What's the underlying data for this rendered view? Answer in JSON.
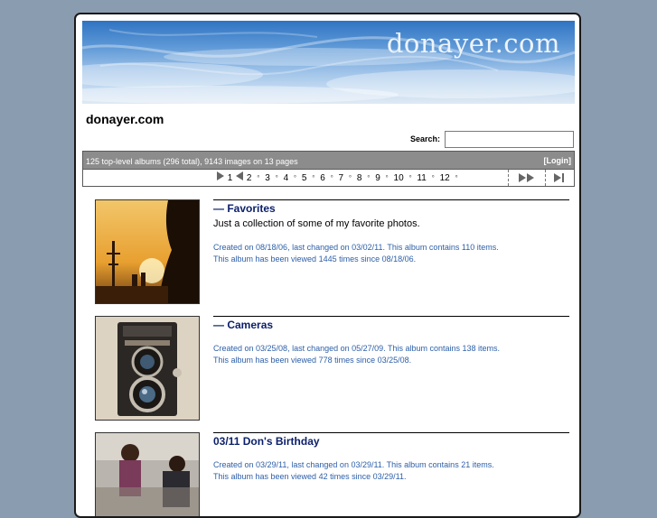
{
  "header": {
    "banner_title": "donayer.com",
    "site_title": "donayer.com",
    "search_label": "Search:",
    "search_value": ""
  },
  "info_bar": {
    "summary": "125 top-level albums (296 total), 9143 images on 13 pages",
    "login": "[Login]"
  },
  "pager": {
    "pages": [
      "1",
      "2",
      "3",
      "4",
      "5",
      "6",
      "7",
      "8",
      "9",
      "10",
      "11",
      "12"
    ]
  },
  "albums": [
    {
      "title": "— Favorites",
      "description": "Just a collection of some of my favorite photos.",
      "meta_line1": "Created on 08/18/06, last changed on 03/02/11. This album contains 110 items.",
      "meta_line2": "This album has been viewed 1445 times since 08/18/06."
    },
    {
      "title": "— Cameras",
      "description": "",
      "meta_line1": "Created on 03/25/08, last changed on 05/27/09. This album contains 138 items.",
      "meta_line2": "This album has been viewed 778 times since 03/25/08."
    },
    {
      "title": "03/11 Don's Birthday",
      "description": "",
      "meta_line1": "Created on 03/29/11, last changed on 03/29/11. This album contains 21 items.",
      "meta_line2": "This album has been viewed 42 times since 03/29/11."
    }
  ],
  "colors": {
    "page_background": "#8a9cb0",
    "album_title": "#0a1f6b",
    "album_meta": "#2d5fa8",
    "info_bar": "#8c8c8c"
  }
}
